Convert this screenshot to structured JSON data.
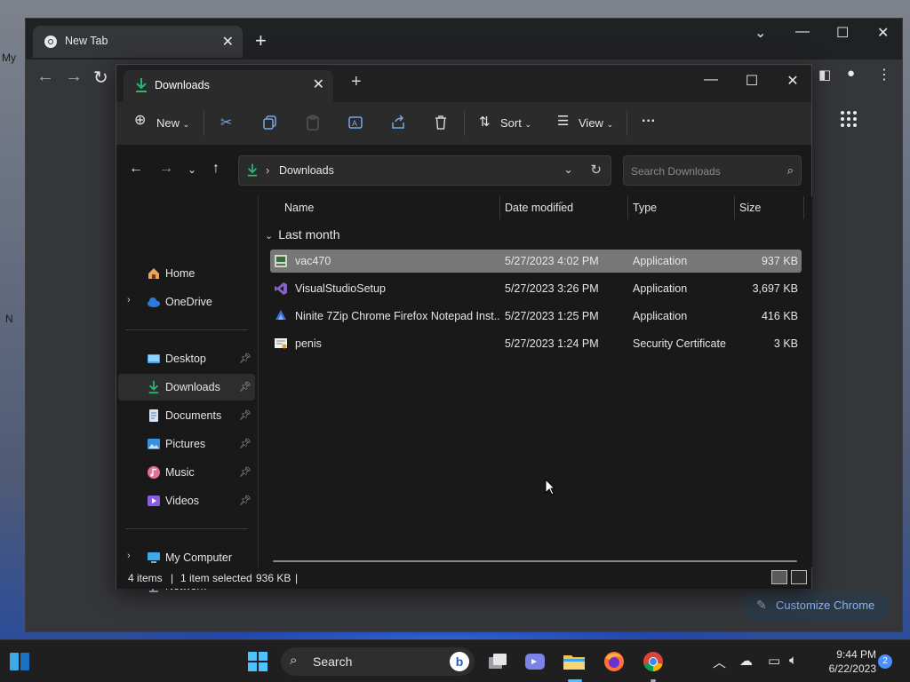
{
  "desktop": {
    "left_text_1": "My",
    "left_text_2": "N"
  },
  "chrome": {
    "tab_title": "New Tab",
    "customize_label": "Customize Chrome"
  },
  "explorer": {
    "tab_title": "Downloads",
    "commandbar": {
      "new_label": "New",
      "sort_label": "Sort",
      "view_label": "View",
      "more_label": "···"
    },
    "address": {
      "path": "Downloads",
      "separator": "›",
      "search_placeholder": "Search Downloads"
    },
    "nav": {
      "home": "Home",
      "onedrive": "OneDrive",
      "desktop": "Desktop",
      "downloads": "Downloads",
      "documents": "Documents",
      "pictures": "Pictures",
      "music": "Music",
      "videos": "Videos",
      "my_computer": "My Computer",
      "network": "Network"
    },
    "columns": {
      "name": "Name",
      "date": "Date modified",
      "type": "Type",
      "size": "Size"
    },
    "group_label": "Last month",
    "files": [
      {
        "name": "vac470",
        "date": "5/27/2023 4:02 PM",
        "type": "Application",
        "size": "937 KB",
        "icon": "installer-icon",
        "selected": true
      },
      {
        "name": "VisualStudioSetup",
        "date": "5/27/2023 3:26 PM",
        "type": "Application",
        "size": "3,697 KB",
        "icon": "visual-studio-icon",
        "selected": false
      },
      {
        "name": "Ninite 7Zip Chrome Firefox Notepad Inst...",
        "date": "5/27/2023 1:25 PM",
        "type": "Application",
        "size": "416 KB",
        "icon": "ninite-icon",
        "selected": false
      },
      {
        "name": "penis",
        "date": "5/27/2023 1:24 PM",
        "type": "Security Certificate",
        "size": "3 KB",
        "icon": "certificate-icon",
        "selected": false
      }
    ],
    "status": {
      "items_count": "4 items",
      "selection": "1 item selected",
      "selection_size": "936 KB",
      "separator": "|"
    }
  },
  "taskbar": {
    "search_label": "Search",
    "bing_label": "b",
    "time": "9:44 PM",
    "date": "6/22/2023",
    "notification_count": "2"
  },
  "colors": {
    "accent": "#4cc2ff",
    "downloads_green": "#2bb673",
    "chrome_link": "#8ab4f8"
  }
}
